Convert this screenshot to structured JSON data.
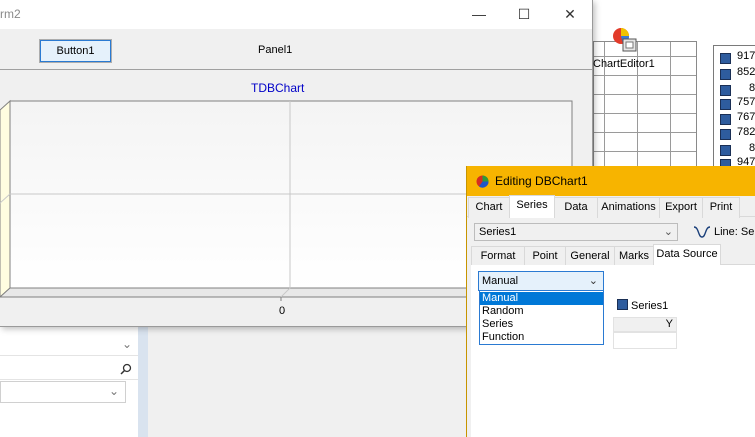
{
  "form2": {
    "title": "rm2",
    "minimize_glyph": "—",
    "maximize_glyph": "☐",
    "close_glyph": "✕",
    "button1_label": "Button1",
    "panel_label": "Panel1",
    "chart": {
      "title": "TDBChart",
      "bottom_axis_tick": "0"
    }
  },
  "ide": {
    "chart_editor_label": "ChartEditor1",
    "listbox_items": [
      "917",
      "852",
      "8",
      "757",
      "767",
      "782",
      "8",
      "947"
    ]
  },
  "editor": {
    "title": "Editing DBChart1",
    "main_tabs": [
      "Chart",
      "Series",
      "Data",
      "Animations",
      "Export",
      "Print"
    ],
    "active_main_tab": "Series",
    "series_selected": "Series1",
    "series_type_label": "Line: Se",
    "sub_tabs": [
      "Format",
      "Point",
      "General",
      "Marks",
      "Data Source"
    ],
    "active_sub_tab": "Data Source",
    "datasource_value": "Manual",
    "datasource_options": [
      "Manual",
      "Random",
      "Series",
      "Function"
    ],
    "datasource_selected": "Manual",
    "legend_series": "Series1",
    "grid_y_header": "Y"
  },
  "colors": {
    "editor_titlebar": "#f7b400",
    "chart_title": "#0000c8",
    "selection": "#0078d7",
    "series_square": "#2e5c9e"
  }
}
